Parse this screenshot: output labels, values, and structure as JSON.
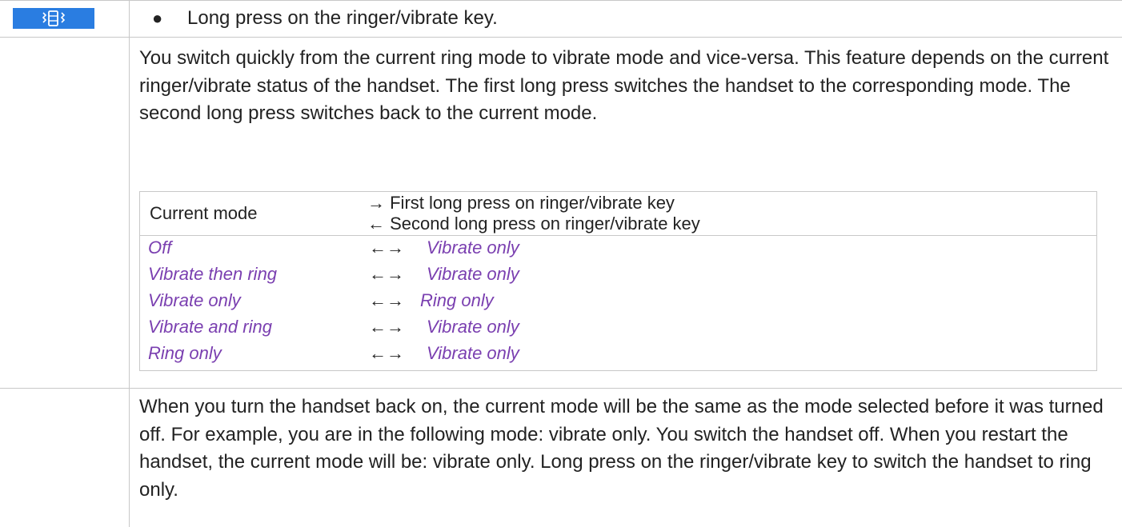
{
  "key": {
    "icon": "ringer-vibrate-key-icon",
    "color": "#2a7de1"
  },
  "action": "Long press on the ringer/vibrate key.",
  "description": "You switch quickly from the current ring mode to vibrate mode and vice-versa. This feature depends on the current ringer/vibrate status of the handset. The first long press switches the handset to the corresponding mode. The second long press switches back to the current mode.",
  "mode_table": {
    "header_label": "Current mode",
    "header_first": "→ First long press on ringer/vibrate key",
    "header_second": "← Second long press on ringer/vibrate key",
    "arrow": "←→",
    "rows": [
      {
        "from": "Off",
        "to": "Vibrate only"
      },
      {
        "from": "Vibrate then ring",
        "to": "Vibrate only"
      },
      {
        "from": "Vibrate only",
        "to": "Ring only"
      },
      {
        "from": "Vibrate and ring",
        "to": "Vibrate only"
      },
      {
        "from": "Ring only",
        "to": "Vibrate only"
      }
    ],
    "mode_text_color": "#7a3fb0"
  },
  "note": "When you turn the handset back on, the current mode will be the same as the mode selected before it was turned off. For example, you are in the following mode: vibrate only. You switch the handset off. When you restart the handset, the current mode will be: vibrate only. Long press on the ringer/vibrate key to switch the handset to ring only."
}
